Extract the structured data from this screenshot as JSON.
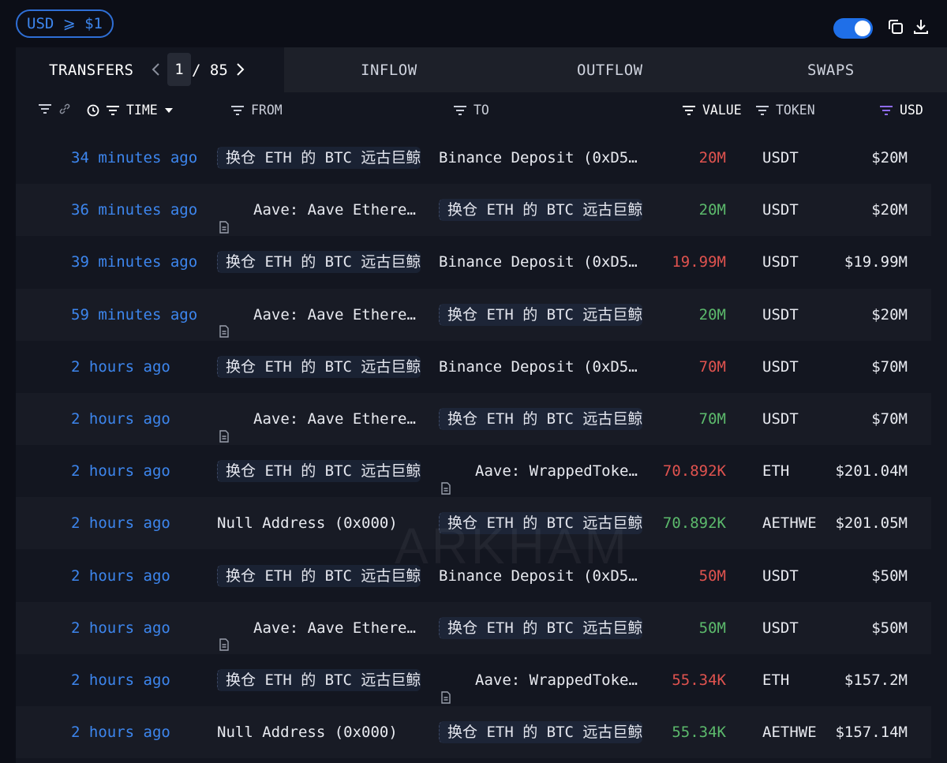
{
  "filter": {
    "label": "USD ⩾ $1"
  },
  "tabs": {
    "transfers": "TRANSFERS",
    "page_current": "1",
    "page_total": "/ 85",
    "inflow": "INFLOW",
    "outflow": "OUTFLOW",
    "swaps": "SWAPS"
  },
  "columns": {
    "time": "TIME",
    "from": "FROM",
    "to": "TO",
    "value": "VALUE",
    "token": "TOKEN",
    "usd": "USD"
  },
  "colors": {
    "accent": "#3d86ee",
    "outflow": "#e0534f",
    "inflow": "#5cba6c"
  },
  "watermark": "ARKHAM",
  "rows": [
    {
      "time": "34 minutes ago",
      "from": "换仓 ETH 的 BTC 远古巨鲸",
      "to": "Binance Deposit (0xD5…",
      "value": "20M",
      "token": "USDT",
      "usd": "$20M"
    },
    {
      "time": "36 minutes ago",
      "from": "Aave: Aave Ethere…",
      "to": "换仓 ETH 的 BTC 远古巨鲸",
      "value": "20M",
      "token": "USDT",
      "usd": "$20M"
    },
    {
      "time": "39 minutes ago",
      "from": "换仓 ETH 的 BTC 远古巨鲸",
      "to": "Binance Deposit (0xD5…",
      "value": "19.99M",
      "token": "USDT",
      "usd": "$19.99M"
    },
    {
      "time": "59 minutes ago",
      "from": "Aave: Aave Ethere…",
      "to": "换仓 ETH 的 BTC 远古巨鲸",
      "value": "20M",
      "token": "USDT",
      "usd": "$20M"
    },
    {
      "time": "2 hours ago",
      "from": "换仓 ETH 的 BTC 远古巨鲸",
      "to": "Binance Deposit (0xD5…",
      "value": "70M",
      "token": "USDT",
      "usd": "$70M"
    },
    {
      "time": "2 hours ago",
      "from": "Aave: Aave Ethere…",
      "to": "换仓 ETH 的 BTC 远古巨鲸",
      "value": "70M",
      "token": "USDT",
      "usd": "$70M"
    },
    {
      "time": "2 hours ago",
      "from": "换仓 ETH 的 BTC 远古巨鲸",
      "to": "Aave: WrappedToke…",
      "value": "70.892K",
      "token": "ETH",
      "usd": "$201.04M"
    },
    {
      "time": "2 hours ago",
      "from": "Null Address (0x000)",
      "to": "换仓 ETH 的 BTC 远古巨鲸",
      "value": "70.892K",
      "token": "AETHWE",
      "usd": "$201.05M"
    },
    {
      "time": "2 hours ago",
      "from": "换仓 ETH 的 BTC 远古巨鲸",
      "to": "Binance Deposit (0xD5…",
      "value": "50M",
      "token": "USDT",
      "usd": "$50M"
    },
    {
      "time": "2 hours ago",
      "from": "Aave: Aave Ethere…",
      "to": "换仓 ETH 的 BTC 远古巨鲸",
      "value": "50M",
      "token": "USDT",
      "usd": "$50M"
    },
    {
      "time": "2 hours ago",
      "from": "换仓 ETH 的 BTC 远古巨鲸",
      "to": "Aave: WrappedToke…",
      "value": "55.34K",
      "token": "ETH",
      "usd": "$157.2M"
    },
    {
      "time": "2 hours ago",
      "from": "Null Address (0x000)",
      "to": "换仓 ETH 的 BTC 远古巨鲸",
      "value": "55.34K",
      "token": "AETHWE",
      "usd": "$157.14M"
    }
  ]
}
